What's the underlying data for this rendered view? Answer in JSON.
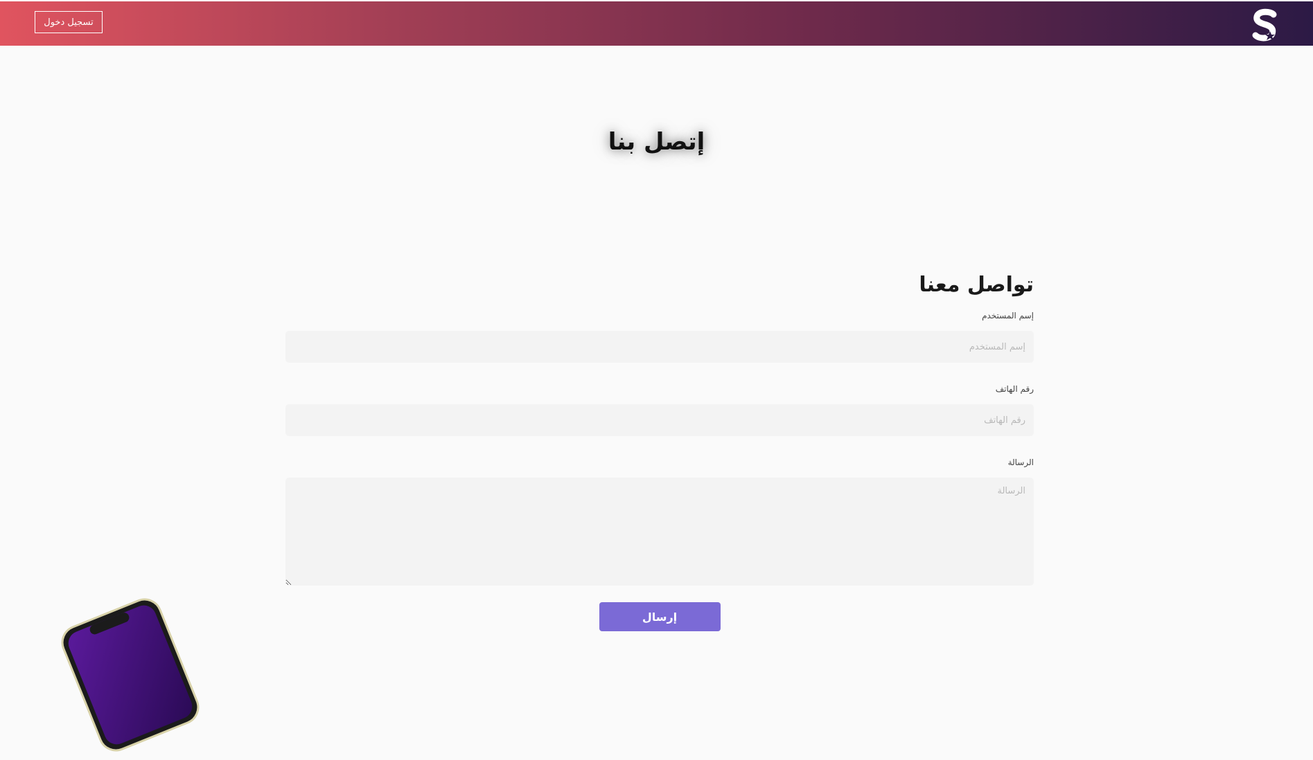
{
  "header": {
    "logo_icon": "s-star-logo-icon",
    "login_label": "تسجيل دخول",
    "gradient": [
      "#e0545f",
      "#a23f55",
      "#6e2a4b",
      "#2c1a45"
    ]
  },
  "hero": {
    "title": "إتصل بنا"
  },
  "contact_form": {
    "heading": "تواصل معنا",
    "username": {
      "label": "إسم المستخدم",
      "placeholder": "إسم المستخدم",
      "value": ""
    },
    "phone": {
      "label": "رقم الهاتف",
      "placeholder": "رقم الهاتف",
      "value": ""
    },
    "message": {
      "label": "الرسالة",
      "placeholder": "الرسالة",
      "value": ""
    },
    "submit_label": "إرسال",
    "accent_color": "#7b6ad6"
  },
  "decoration": {
    "phone_icon": "phone-illustration-icon"
  }
}
